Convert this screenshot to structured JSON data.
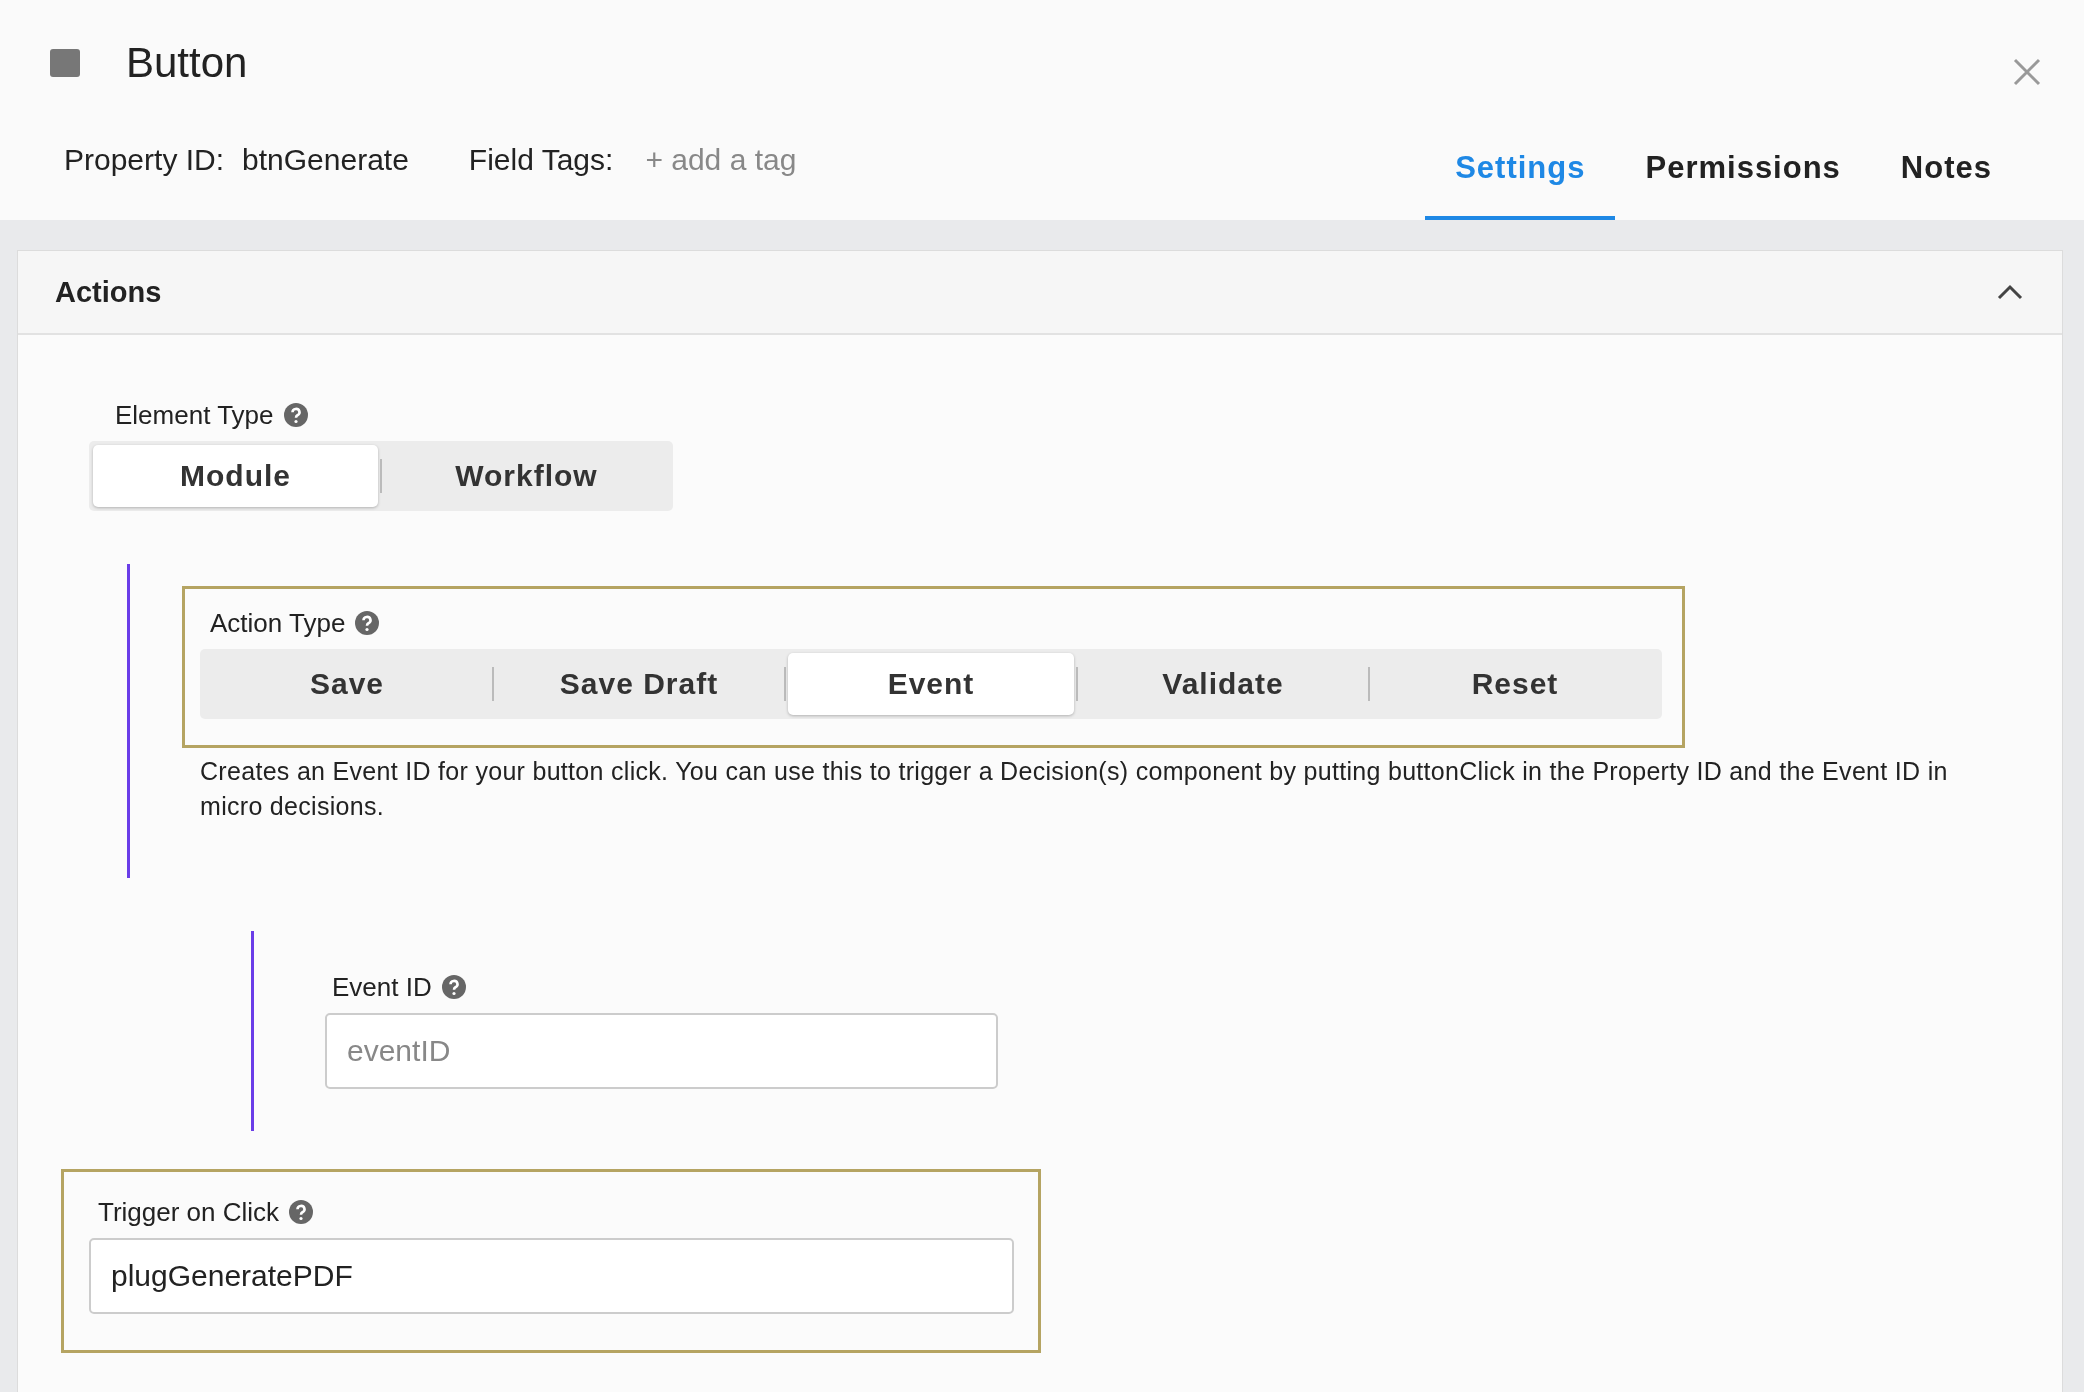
{
  "window": {
    "title": "Button"
  },
  "header": {
    "property_id_label": "Property ID:",
    "property_id": "btnGenerate",
    "field_tags_label": "Field Tags:",
    "add_tag": "+ add a tag"
  },
  "tabs": [
    {
      "label": "Settings",
      "selected": true
    },
    {
      "label": "Permissions",
      "selected": false
    },
    {
      "label": "Notes",
      "selected": false
    }
  ],
  "panel": {
    "title": "Actions",
    "expanded": true,
    "element_type": {
      "label": "Element Type",
      "options": [
        {
          "label": "Module",
          "selected": true
        },
        {
          "label": "Workflow",
          "selected": false
        }
      ]
    },
    "action_type": {
      "label": "Action Type",
      "highlighted": true,
      "options": [
        {
          "label": "Save",
          "selected": false
        },
        {
          "label": "Save Draft",
          "selected": false
        },
        {
          "label": "Event",
          "selected": true
        },
        {
          "label": "Validate",
          "selected": false
        },
        {
          "label": "Reset",
          "selected": false
        }
      ],
      "description": "Creates an Event ID for your button click. You can use this to trigger a Decision(s) component by putting buttonClick in the Property ID and the Event ID in micro decisions."
    },
    "event_id": {
      "label": "Event ID",
      "placeholder": "eventID"
    },
    "trigger_on_click": {
      "label": "Trigger on Click",
      "highlighted": true,
      "value": "plugGeneratePDF"
    }
  }
}
